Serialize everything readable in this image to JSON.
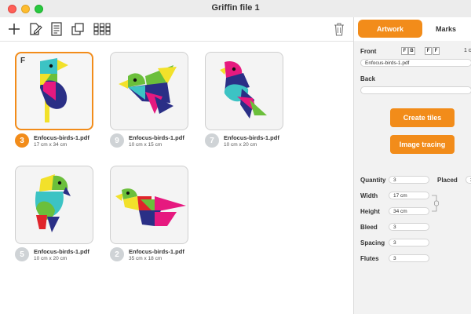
{
  "window": {
    "title": "Griffin file 1"
  },
  "toolbar": {
    "icons": [
      "plus-icon",
      "edit-icon",
      "document-icon",
      "duplicate-icon",
      "grid-icon",
      "trash-icon"
    ]
  },
  "gallery": {
    "selected_marker": "F",
    "items": [
      {
        "number": "3",
        "filename": "Enfocus-birds-1.pdf",
        "size": "17 cm x 34 cm",
        "selected": true
      },
      {
        "number": "9",
        "filename": "Enfocus-birds-1.pdf",
        "size": "10 cm x 15 cm",
        "selected": false
      },
      {
        "number": "7",
        "filename": "Enfocus-birds-1.pdf",
        "size": "10 cm x 20 cm",
        "selected": false
      },
      {
        "number": "5",
        "filename": "Enfocus-birds-1.pdf",
        "size": "10 cm x 20 cm",
        "selected": false
      },
      {
        "number": "2",
        "filename": "Enfocus-birds-1.pdf",
        "size": "35 cm x 18 cm",
        "selected": false
      }
    ]
  },
  "panel": {
    "tabs": {
      "artwork": "Artwork",
      "marks": "Marks"
    },
    "front": {
      "label": "Front",
      "toggle_a": [
        "F",
        "B"
      ],
      "toggle_b": [
        "F",
        "F"
      ],
      "extra": "1 c",
      "file": "Enfocus-birds-1.pdf"
    },
    "back": {
      "label": "Back",
      "file": ""
    },
    "buttons": {
      "create_tiles": "Create tiles",
      "image_tracing": "Image tracing"
    },
    "fields": {
      "quantity_label": "Quantity",
      "quantity_value": "3",
      "placed_label": "Placed",
      "placed_value": "3",
      "width_label": "Width",
      "width_value": "17 cm",
      "height_label": "Height",
      "height_value": "34 cm",
      "bleed_label": "Bleed",
      "bleed_value": "3",
      "spacing_label": "Spacing",
      "spacing_value": "3",
      "flutes_label": "Flutes",
      "flutes_value": "3"
    }
  },
  "colors": {
    "accent": "#f28c1a",
    "badge_inactive": "#cfd3d6",
    "bird_pink": "#e6197f",
    "bird_teal": "#3cc3c4",
    "bird_navy": "#2a2f86",
    "bird_green": "#6bbf3b",
    "bird_yellow": "#f2e12a",
    "bird_red": "#e0242b"
  }
}
